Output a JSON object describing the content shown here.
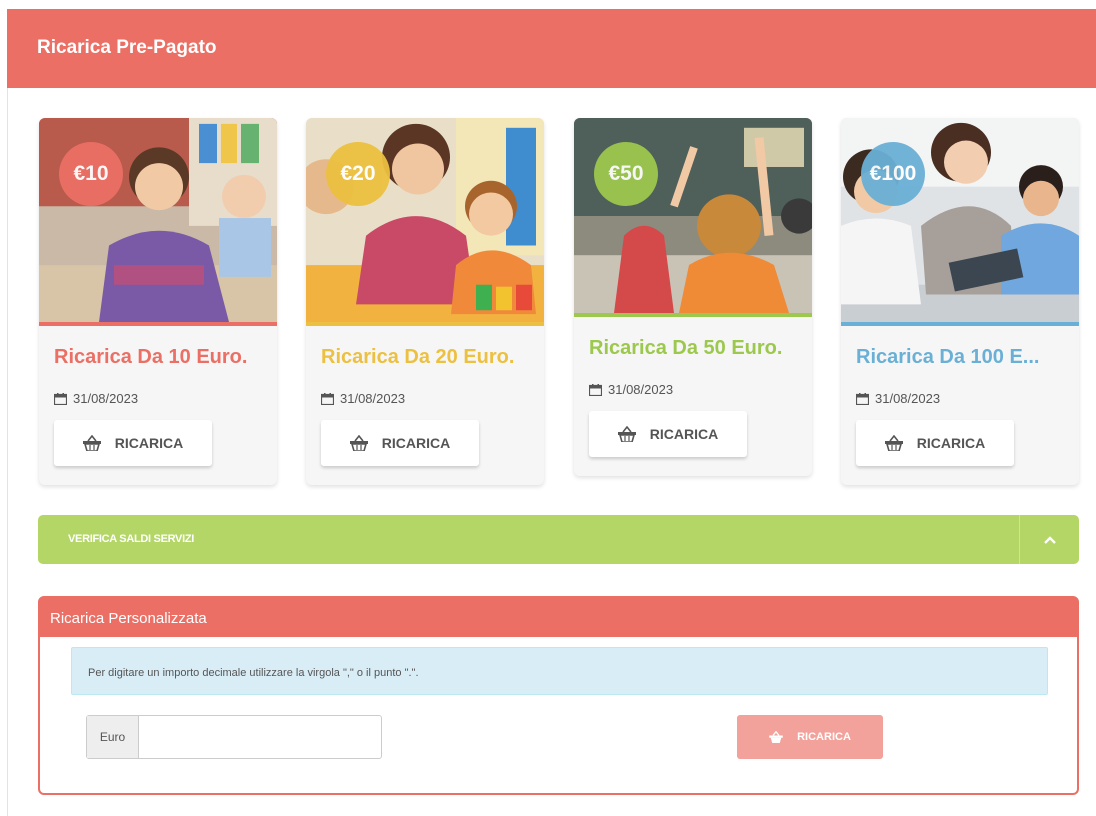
{
  "header": {
    "title": "Ricarica Pre-Pagato"
  },
  "cards": [
    {
      "price": "€10",
      "title": "Ricarica Da 10 Euro.",
      "date": "31/08/2023",
      "button": "RICARICA",
      "color": "#eb6f64"
    },
    {
      "price": "€20",
      "title": "Ricarica Da 20 Euro.",
      "date": "31/08/2023",
      "button": "RICARICA",
      "color": "#ecc040"
    },
    {
      "price": "€50",
      "title": "Ricarica Da 50 Euro.",
      "date": "31/08/2023",
      "button": "RICARICA",
      "color": "#9cc84d"
    },
    {
      "price": "€100",
      "title": "Ricarica Da 100 E...",
      "date": "31/08/2023",
      "button": "RICARICA",
      "color": "#6ab0d6"
    }
  ],
  "verifica": {
    "label": "VERIFICA SALDI SERVIZI",
    "toggle_icon": "chevron-up-icon",
    "color": "#b3d667"
  },
  "custom": {
    "title": "Ricarica Personalizzata",
    "info": "Per digitare un importo decimale utilizzare la virgola \",\" o il punto \".\".",
    "input_addon": "Euro",
    "input_value": "",
    "button": "RICARICA",
    "accent": "#eb6f64"
  }
}
